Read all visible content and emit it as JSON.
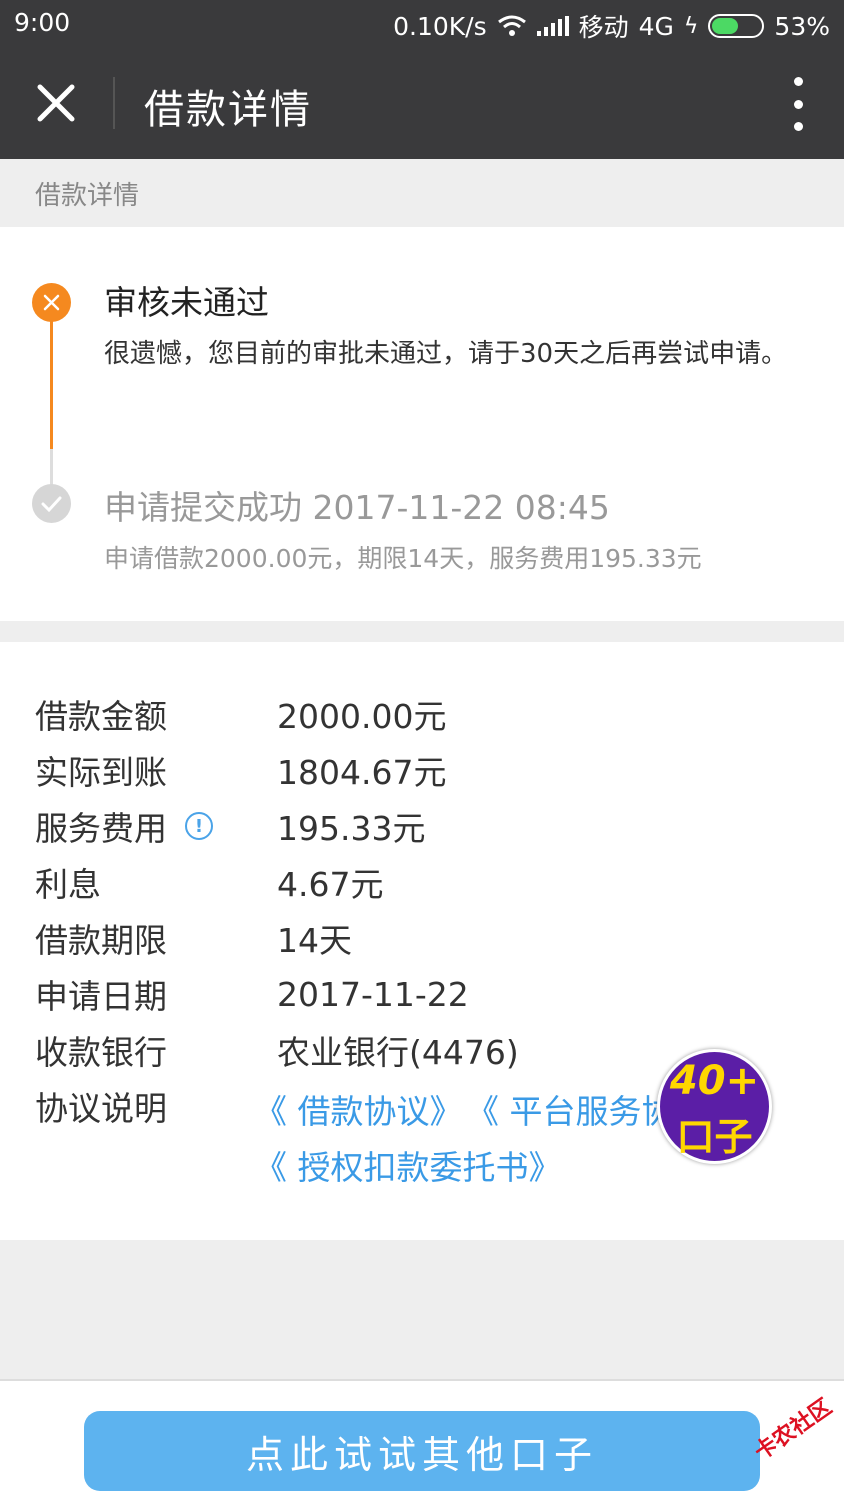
{
  "status_bar": {
    "time": "9:00",
    "network_speed": "0.10K/s",
    "carrier": "移动",
    "network_type": "4G",
    "battery": "53%",
    "battery_level": 0.53
  },
  "header": {
    "title": "借款详情",
    "close_icon": "close-icon",
    "menu_icon": "more-vertical-icon"
  },
  "section_label": "借款详情",
  "timeline": [
    {
      "title": "审核未通过",
      "description": "很遗憾，您目前的审批未通过，请于30天之后再尝试申请。",
      "status": "failed",
      "color": "#f5891f"
    },
    {
      "title": "申请提交成功 2017-11-22 08:45",
      "description": "申请借款2000.00元，期限14天，服务费用195.33元",
      "status": "done",
      "color": "#d6d6d6"
    }
  ],
  "details": [
    {
      "label": "借款金额",
      "value": "2000.00元"
    },
    {
      "label": "实际到账",
      "value": "1804.67元"
    },
    {
      "label": "服务费用",
      "value": "195.33元"
    },
    {
      "label": "利息",
      "value": "4.67元"
    },
    {
      "label": "借款期限",
      "value": "14天"
    },
    {
      "label": "申请日期",
      "value": "2017-11-22"
    },
    {
      "label": "收款银行",
      "value": "农业银行(4476)"
    }
  ],
  "agreements": {
    "label": "协议说明",
    "links": [
      "《 借款协议》",
      "《 平台服务协",
      "《 授权扣款委托书》"
    ]
  },
  "badge": {
    "line1": "40+",
    "line2": "口子"
  },
  "action_button": "点此试试其他口子",
  "watermark": "卡农社区",
  "colors": {
    "accent": "#5db3ef",
    "link": "#3a9ae6",
    "warning": "#f5891f",
    "header_bg": "#3a3a3c"
  }
}
